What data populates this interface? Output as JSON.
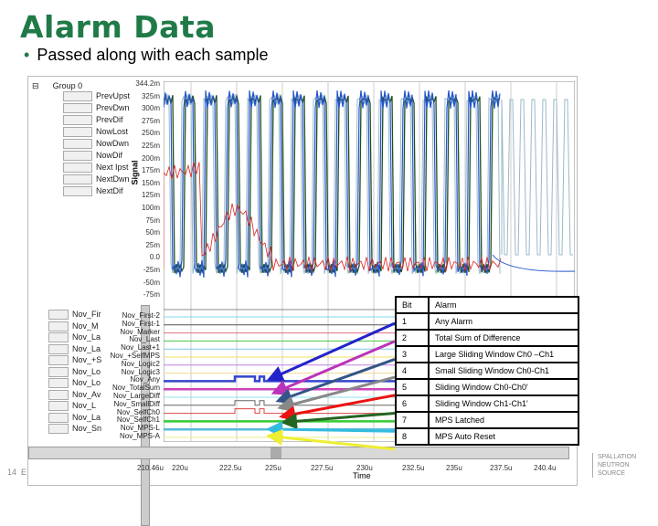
{
  "slide": {
    "title": "Alarm Data",
    "bullet": "Passed along with each sample",
    "page_number": "14",
    "page_suffix": "E",
    "logo": [
      "SPALLATION",
      "NEUTRON",
      "SOURCE"
    ]
  },
  "legend": {
    "group": "Group 0",
    "items": [
      "PrevUpst",
      "PrevDwn",
      "PrevDif",
      "NowLost",
      "NowDwn",
      "NowDif",
      "Next Ipst",
      "NextDwn",
      "NextDif"
    ]
  },
  "digital_legend": [
    "Nov_Fir",
    "Nov_M",
    "Nov_La",
    "Nov_La",
    "Nov_+S",
    "Nov_Lo",
    "Nov_Lo",
    "Nov_Av",
    "Nov_L",
    "Nov_La",
    "Nov_Sn"
  ],
  "y_axis": {
    "label": "Signal",
    "ticks": [
      "344.2m",
      "325m",
      "300m",
      "275m",
      "250m",
      "225m",
      "200m",
      "175m",
      "150m",
      "125m",
      "100m",
      "75m",
      "50m",
      "25m",
      "0.0",
      "-25m",
      "-50m",
      "-75m"
    ]
  },
  "digital_traces": [
    {
      "label": "Nov_First-2",
      "color": "#7fd8e8"
    },
    {
      "label": "Nov_First-1",
      "color": "#555555"
    },
    {
      "label": "Nov_Marker",
      "color": "#e07080"
    },
    {
      "label": "Nov_Last",
      "color": "#44cc44"
    },
    {
      "label": "Nov_Last+1",
      "color": "#80c8e8"
    },
    {
      "label": "Nov_+SelfMPS",
      "color": "#f0e060"
    },
    {
      "label": "Nov_Logic2",
      "color": "#c080e0"
    },
    {
      "label": "Nov_Logic3",
      "color": "#f0d890"
    },
    {
      "label": "Nov_Any",
      "color": "#3344cc"
    },
    {
      "label": "Nov_TotalSum",
      "color": "#cc44bb"
    },
    {
      "label": "Nov_LargeDiff",
      "color": "#90e0e8"
    },
    {
      "label": "Nov_SmallDiff",
      "color": "#666666"
    },
    {
      "label": "Nov_SelfCh0",
      "color": "#dd4444"
    },
    {
      "label": "Nov_SelfCh1",
      "color": "#33cc33"
    },
    {
      "label": "Nov_MPS-L",
      "color": "#55bbdd"
    },
    {
      "label": "Nov_MPS-A",
      "color": "#eeee88"
    }
  ],
  "x_axis": {
    "label": "Time",
    "ticks": [
      "210.46u",
      "220u",
      "222.5u",
      "225u",
      "227.5u",
      "230u",
      "232.5u",
      "235u",
      "237.5u",
      "240.4u"
    ]
  },
  "alarm_table": {
    "headers": [
      "Bit",
      "Alarm"
    ],
    "rows": [
      [
        "1",
        "Any Alarm"
      ],
      [
        "2",
        "Total Sum of Difference"
      ],
      [
        "3",
        "Large Sliding Window Ch0 –Ch1"
      ],
      [
        "4",
        "Small Sliding Window Ch0-Ch1"
      ],
      [
        "5",
        "Sliding Window Ch0-Ch0'"
      ],
      [
        "6",
        "Sliding Window Ch1-Ch1'"
      ],
      [
        "7",
        "MPS Latched"
      ],
      [
        "8",
        "MPS Auto Reset"
      ]
    ]
  },
  "arrow_colors": [
    "#2222cc",
    "#bb33bb",
    "#335588",
    "#888888",
    "#ee1111",
    "#226622",
    "#33bbdd",
    "#eeee33"
  ],
  "colors": {
    "title": "#1f7a47",
    "now_lost": "#1f4f1f",
    "now_dwn": "#2255cc",
    "now_dif": "#dd2222",
    "prev": "#9ab8c8"
  }
}
